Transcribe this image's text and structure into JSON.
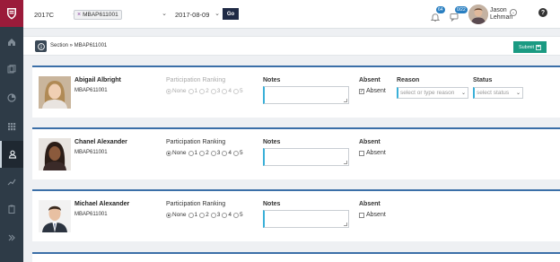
{
  "topbar": {
    "term": "2017C",
    "section_chip": "MBAP611001",
    "date": "2017-08-09",
    "go_label": "Go",
    "notifications": [
      {
        "badge": "64"
      },
      {
        "badge": "0/22"
      }
    ],
    "user_first": "Jason",
    "user_last": "Lehman",
    "help_label": "?"
  },
  "sectionbar": {
    "breadcrumb": "Section » MBAP611001",
    "submit_label": "Submit"
  },
  "labels": {
    "participation": "Participation Ranking",
    "notes": "Notes",
    "absent": "Absent",
    "absent_opt": "Absent",
    "reason": "Reason",
    "status": "Status",
    "reason_placeholder": "select or type reason",
    "status_placeholder": "select status",
    "none": "None",
    "r1": "1",
    "r2": "2",
    "r3": "3",
    "r4": "4",
    "r5": "5"
  },
  "students": [
    {
      "name": "Abigail Albright",
      "id": "MBAP611001",
      "absent": true
    },
    {
      "name": "Chanel Alexander",
      "id": "MBAP611001",
      "absent": false
    },
    {
      "name": "Michael Alexander",
      "id": "MBAP611001",
      "absent": false
    }
  ],
  "colors": {
    "sidebar": "#2e3b47",
    "logo": "#9b1b3a",
    "go": "#1f2a45",
    "submit": "#1a9a82",
    "card_accent": "#3b6fa8",
    "field_accent": "#3ab0d8",
    "badge": "#2a7fc1"
  }
}
